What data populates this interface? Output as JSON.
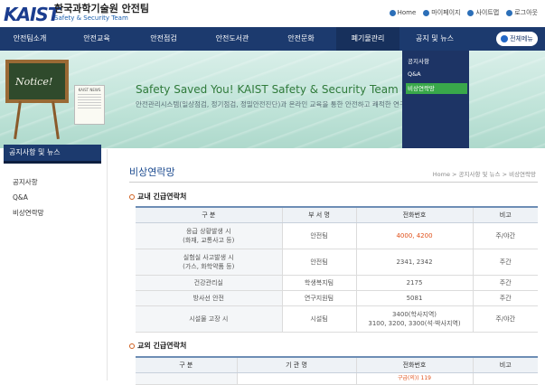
{
  "header": {
    "logo": "KAIST",
    "inst_name_ko": "한국과학기술원 안전팀",
    "inst_name_en": "Safety & Security Team",
    "util_links": [
      {
        "icon": "home-icon",
        "label": "Home"
      },
      {
        "icon": "user-icon",
        "label": "마이페이지"
      },
      {
        "icon": "sitemap-icon",
        "label": "사이트맵"
      },
      {
        "icon": "login-icon",
        "label": "로그아웃"
      }
    ]
  },
  "nav": {
    "items": [
      "안전팀소개",
      "안전교육",
      "안전점검",
      "안전도서관",
      "안전문화",
      "폐기물관리",
      "공지 및 뉴스"
    ],
    "all_menu": "전체메뉴"
  },
  "dropdown": {
    "items": [
      "공지사항",
      "Q&A",
      "비상연락망"
    ],
    "highlight_index": 2
  },
  "banner": {
    "notice_board": "Notice!",
    "paper_title": "KAIST NEWS",
    "slogan": "Safety Saved You! KAIST Safety & Security Team",
    "subtext": "안전관리시스템(일상점검, 정기점검, 정밀안전진단)과 온라인 교육을 통한 안전하고 쾌적한 연구환경 조성"
  },
  "sidebar": {
    "title": "공지사항 및 뉴스",
    "items": [
      "공지사항",
      "Q&A",
      "비상연락망"
    ]
  },
  "main": {
    "title": "비상연락망",
    "breadcrumb": "Home > 공지사항 및 뉴스 > 비상연락망",
    "section1": "교내 긴급연락처",
    "table1": {
      "headers": [
        "구 분",
        "부 서 명",
        "전화번호",
        "비고"
      ],
      "rows": [
        {
          "c1": "응급 상황발생 시",
          "c1b": "(화재, 교통사고 등)",
          "c2": "안전팀",
          "c3": "4000, 4200",
          "c3b": "",
          "c4": "주/야간",
          "red": true
        },
        {
          "c1": "실험실 사고발생 시",
          "c1b": "(가스, 화학약품 등)",
          "c2": "안전팀",
          "c3": "2341, 2342",
          "c3b": "",
          "c4": "주간",
          "red": false
        },
        {
          "c1": "건강관리실",
          "c1b": "",
          "c2": "학생복지팀",
          "c3": "2175",
          "c3b": "",
          "c4": "주간",
          "red": false
        },
        {
          "c1": "방사선 안전",
          "c1b": "",
          "c2": "연구지원팀",
          "c3": "5081",
          "c3b": "",
          "c4": "주간",
          "red": false
        },
        {
          "c1": "시설물 고장 시",
          "c1b": "",
          "c2": "시설팀",
          "c3": "3400(학사지역)",
          "c3b": "3100, 3200, 3300(석·박사지역)",
          "c4": "주/야간",
          "red": false
        }
      ]
    },
    "section2": "교외 긴급연락처",
    "table2": {
      "headers": [
        "구 분",
        "기 관 명",
        "전화번호",
        "비고"
      ],
      "partial_row": "구급(의)) 119"
    }
  }
}
